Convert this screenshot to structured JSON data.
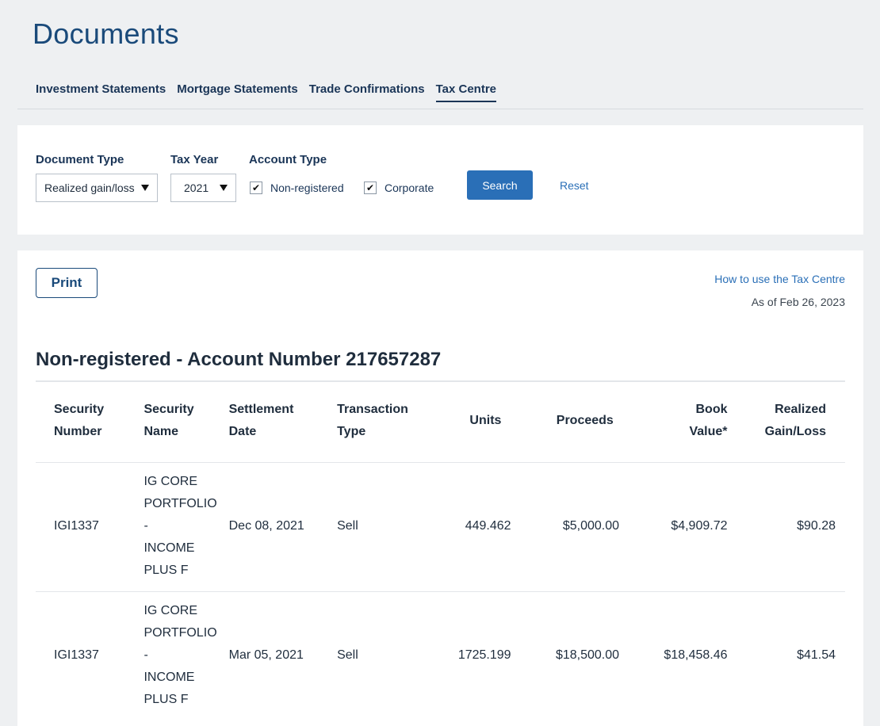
{
  "page": {
    "title": "Documents"
  },
  "tabs": [
    {
      "label": "Investment Statements"
    },
    {
      "label": "Mortgage Statements"
    },
    {
      "label": "Trade Confirmations"
    },
    {
      "label": "Tax Centre"
    }
  ],
  "filters": {
    "document_type": {
      "label": "Document Type",
      "value": "Realized gain/loss"
    },
    "tax_year": {
      "label": "Tax Year",
      "value": "2021"
    },
    "account_type": {
      "label": "Account Type",
      "options": [
        {
          "label": "Non-registered",
          "checked": true
        },
        {
          "label": "Corporate",
          "checked": true
        }
      ]
    },
    "search_label": "Search",
    "reset_label": "Reset",
    "check_glyph": "✔"
  },
  "results": {
    "print_label": "Print",
    "help_link": "How to use the Tax Centre",
    "as_of": "As of Feb 26, 2023",
    "section_title": "Non-registered - Account Number 217657287",
    "columns": [
      {
        "l1": "Security",
        "l2": "Number"
      },
      {
        "l1": "Security",
        "l2": "Name"
      },
      {
        "l1": "Settlement",
        "l2": "Date"
      },
      {
        "l1": "Transaction",
        "l2": "Type"
      },
      {
        "l1": "Units",
        "l2": ""
      },
      {
        "l1": "Proceeds",
        "l2": ""
      },
      {
        "l1": "Book",
        "l2": "Value*"
      },
      {
        "l1": "Realized",
        "l2": "Gain/Loss"
      }
    ],
    "rows": [
      {
        "security_number": "IGI1337",
        "security_name": [
          "IG CORE",
          "PORTFOLIO",
          "-",
          "INCOME",
          "PLUS F"
        ],
        "settlement_date": "Dec 08, 2021",
        "transaction_type": "Sell",
        "units": "449.462",
        "proceeds": "$5,000.00",
        "book_value": "$4,909.72",
        "realized": "$90.28"
      },
      {
        "security_number": "IGI1337",
        "security_name": [
          "IG CORE",
          "PORTFOLIO",
          "-",
          "INCOME",
          "PLUS F"
        ],
        "settlement_date": "Mar 05, 2021",
        "transaction_type": "Sell",
        "units": "1725.199",
        "proceeds": "$18,500.00",
        "book_value": "$18,458.46",
        "realized": "$41.54"
      }
    ]
  }
}
